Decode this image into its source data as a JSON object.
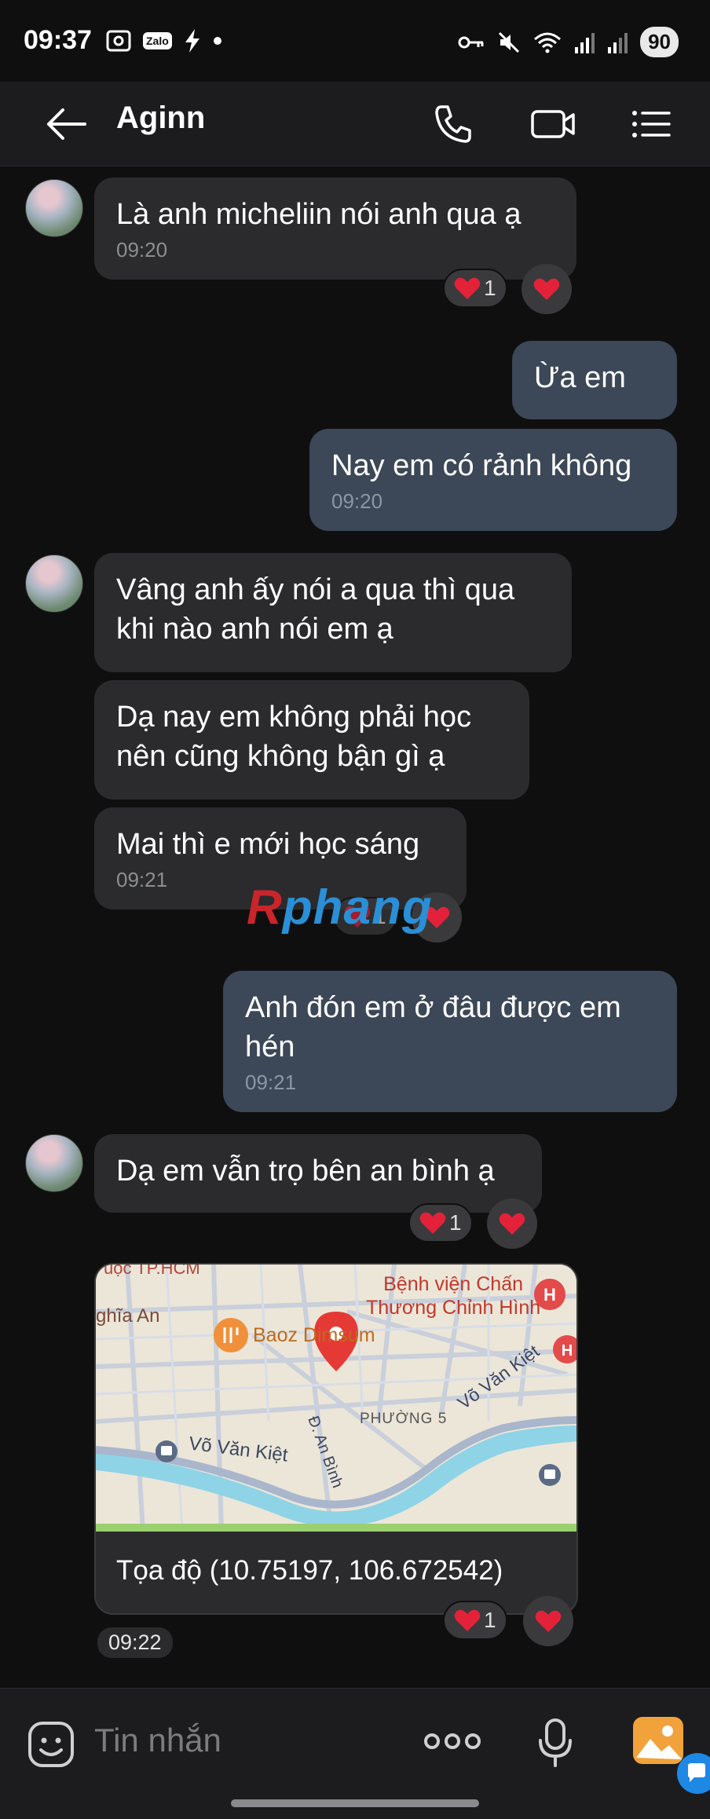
{
  "status_bar": {
    "time": "09:37",
    "battery": "90",
    "zalo_label": "Zalo"
  },
  "header": {
    "title": "Aginn"
  },
  "messages": [
    {
      "text": "Là anh micheliin nói anh qua ạ",
      "time": "09:20"
    },
    {
      "text": "Ừa em"
    },
    {
      "text": "Nay em có rảnh không",
      "time": "09:20"
    },
    {
      "line1": "Vâng anh ấy nói a qua thì qua",
      "line2": "khi nào anh nói em ạ"
    },
    {
      "line1": "Dạ nay em không phải học",
      "line2": "nên cũng không bận gì ạ"
    },
    {
      "text": "Mai thì e mới học sáng",
      "time": "09:21"
    },
    {
      "line1": "Anh đón em ở đâu được em",
      "line2": "hén",
      "time": "09:21"
    },
    {
      "text": "Dạ em vẫn trọ bên an bình ạ"
    }
  ],
  "reactions": {
    "count": "1"
  },
  "location": {
    "coords_text": "Tọa độ (10.75197, 106.672542)",
    "map_labels": {
      "hospital_line1": "Bệnh viện Chấn",
      "hospital_line2": "Thương Chỉnh Hình",
      "restaurant": "Baoz Dimsum",
      "ward": "PHƯỜNG 5",
      "street_vvk_left": "Võ Văn Kiệt",
      "street_vvk_right": "Võ Văn Kiệt",
      "street_an_binh": "Đ. An Bình",
      "area_nghia_an": "ghĩa An",
      "top_cut": "uọc TP.HCM"
    }
  },
  "time_chip": "09:22",
  "input": {
    "placeholder": "Tin nhắn"
  },
  "watermark": {
    "r": "R",
    "rest": "phang"
  },
  "colors": {
    "bubble_in": "#2b2b2d",
    "bubble_out": "#3c4757",
    "heart": "#e3223a",
    "pin": "#e53935"
  },
  "icons": [
    "back-arrow-icon",
    "phone-icon",
    "video-icon",
    "menu-list-icon",
    "heart-icon",
    "sticker-icon",
    "more-icon",
    "mic-icon",
    "image-icon",
    "map-pin-icon"
  ]
}
